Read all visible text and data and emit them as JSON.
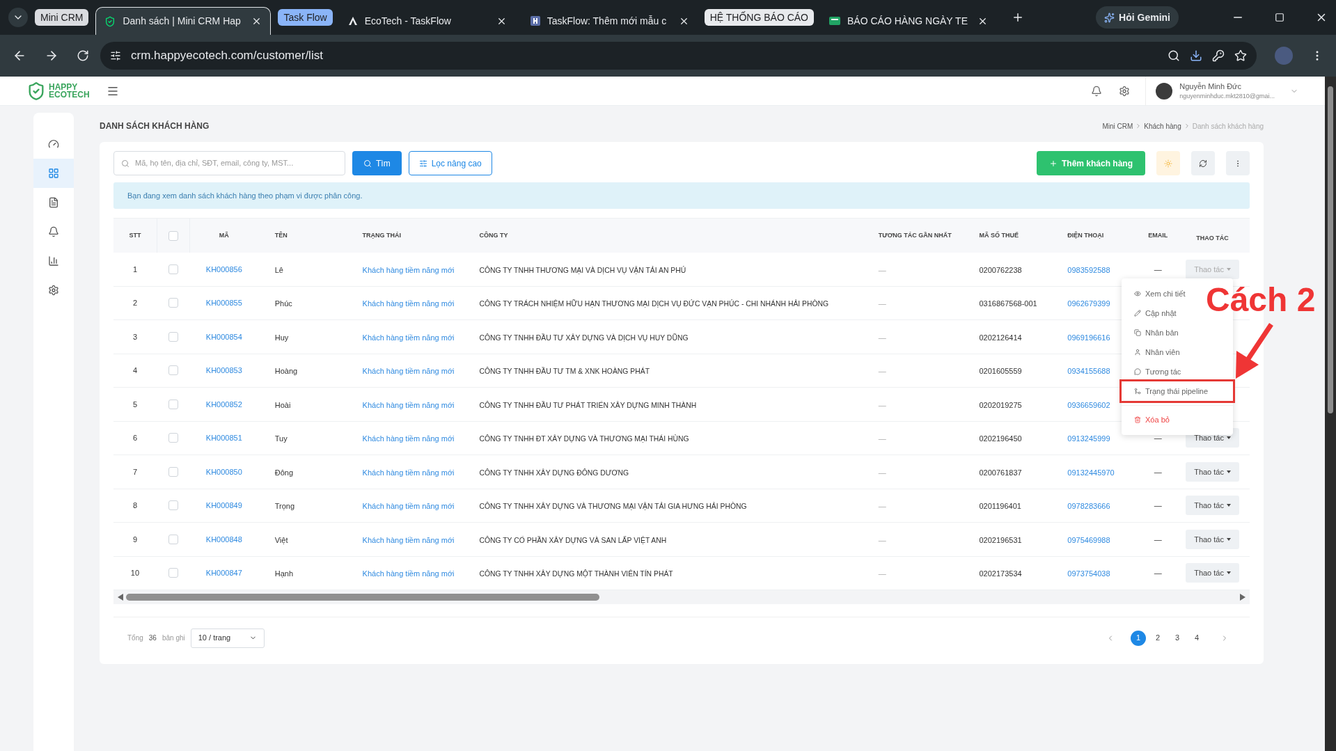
{
  "browser": {
    "tabs": [
      {
        "kind": "group",
        "label": "Mini CRM",
        "color": "#dadce0"
      },
      {
        "kind": "tab",
        "label": "Danh sách | Mini CRM Hap",
        "selected": true
      },
      {
        "kind": "group",
        "label": "Task Flow",
        "color": "#8ab4f8"
      },
      {
        "kind": "tab",
        "label": "EcoTech - TaskFlow",
        "selected": false
      },
      {
        "kind": "tab",
        "label": "TaskFlow: Thêm mới mẫu c",
        "selected": false
      },
      {
        "kind": "group",
        "label": "HỆ THỐNG BÁO CÁO",
        "color": "#e8eaed"
      },
      {
        "kind": "tab",
        "label": "BÁO CÁO HÀNG NGÀY TE",
        "selected": false
      }
    ],
    "gemini": "Hỏi Gemini",
    "url": "crm.happyecotech.com/customer/list"
  },
  "app": {
    "logo_top": "HAPPY",
    "logo_bottom": "ECOTECH",
    "user_name": "Nguyễn Minh Đức",
    "user_email": "nguyenminhduc.mkt2810@gmai..."
  },
  "sidebar": {
    "items": [
      {
        "selected": false
      },
      {
        "selected": true
      },
      {
        "selected": false
      },
      {
        "selected": false
      },
      {
        "selected": false
      },
      {
        "selected": false
      }
    ]
  },
  "page": {
    "title": "DANH SÁCH KHÁCH HÀNG",
    "breadcrumbs": [
      "Mini CRM",
      "Khách hàng",
      "Danh sách khách hàng"
    ]
  },
  "toolbar": {
    "search_placeholder": "Mã, họ tên, địa chỉ, SĐT, email, công ty, MST...",
    "search_button": "Tìm",
    "filter_button": "Lọc nâng cao",
    "add_button": "Thêm khách hàng"
  },
  "notice": "Bạn đang xem danh sách khách hàng theo phạm vi được phân công.",
  "table": {
    "columns": [
      "STT",
      "MÃ",
      "TÊN",
      "TRẠNG THÁI",
      "CÔNG TY",
      "TƯƠNG TÁC GẦN NHẤT",
      "MÃ SỐ THUẾ",
      "ĐIỆN THOẠI",
      "EMAIL",
      "THAO TÁC"
    ],
    "all_checked": false,
    "rows": [
      {
        "stt": "1",
        "checked": false,
        "code": "KH000856",
        "name": "Lê",
        "status": "Khách hàng tiềm năng mới",
        "company": "CÔNG TY TNHH THƯƠNG MẠI VÀ DỊCH VỤ VẬN TẢI AN PHÚ",
        "last": "—",
        "tax": "0200762238",
        "phone": "0983592588",
        "email": "—",
        "action": "Thao tác",
        "open": true
      },
      {
        "stt": "2",
        "checked": false,
        "code": "KH000855",
        "name": "Phúc",
        "status": "Khách hàng tiềm năng mới",
        "company": "CÔNG TY TRÁCH NHIỆM HỮU HẠN THƯƠNG MẠI DỊCH VỤ ĐỨC VẠN PHÚC - CHI NHÁNH HẢI PHÒNG",
        "last": "—",
        "tax": "0316867568-001",
        "phone": "0962679399"
      },
      {
        "stt": "3",
        "checked": false,
        "code": "KH000854",
        "name": "Huy",
        "status": "Khách hàng tiềm năng mới",
        "company": "CÔNG TY TNHH ĐẦU TƯ XÂY DỰNG VÀ DỊCH VỤ HUY DŨNG",
        "last": "—",
        "tax": "0202126414",
        "phone": "0969196616"
      },
      {
        "stt": "4",
        "checked": false,
        "code": "KH000853",
        "name": "Hoàng",
        "status": "Khách hàng tiềm năng mới",
        "company": "CÔNG TY TNHH ĐẦU TƯ TM & XNK HOÀNG PHÁT",
        "last": "—",
        "tax": "0201605559",
        "phone": "0934155688"
      },
      {
        "stt": "5",
        "checked": false,
        "code": "KH000852",
        "name": "Hoài",
        "status": "Khách hàng tiềm năng mới",
        "company": "CÔNG TY TNHH ĐẦU TƯ PHÁT TRIỂN XÂY DỰNG MINH THÀNH",
        "last": "—",
        "tax": "0202019275",
        "phone": "0936659602"
      },
      {
        "stt": "6",
        "checked": false,
        "code": "KH000851",
        "name": "Tuy",
        "status": "Khách hàng tiềm năng mới",
        "company": "CÔNG TY TNHH ĐT XÂY DỰNG VÀ THƯƠNG MẠI THÁI HÙNG",
        "last": "—",
        "tax": "0202196450",
        "phone": "0913245999",
        "email": "—",
        "action": "Thao tác",
        "open": false
      },
      {
        "stt": "7",
        "checked": false,
        "code": "KH000850",
        "name": "Đông",
        "status": "Khách hàng tiềm năng mới",
        "company": "CÔNG TY TNHH XÂY DỰNG ĐÔNG DƯƠNG",
        "last": "—",
        "tax": "0200761837",
        "phone": "09132445970",
        "email": "—",
        "action": "Thao tác",
        "open": false
      },
      {
        "stt": "8",
        "checked": false,
        "code": "KH000849",
        "name": "Trọng",
        "status": "Khách hàng tiềm năng mới",
        "company": "CÔNG TY TNHH XÂY DỰNG VÀ THƯƠNG MẠI VẬN TẢI GIA HƯNG HẢI PHÒNG",
        "last": "—",
        "tax": "0201196401",
        "phone": "0978283666",
        "email": "—",
        "action": "Thao tác",
        "open": false
      },
      {
        "stt": "9",
        "checked": false,
        "code": "KH000848",
        "name": "Việt",
        "status": "Khách hàng tiềm năng mới",
        "company": "CÔNG TY CỔ PHẦN XÂY DỰNG VÀ SAN LẤP VIỆT ANH",
        "last": "—",
        "tax": "0202196531",
        "phone": "0975469988",
        "email": "—",
        "action": "Thao tác",
        "open": false
      },
      {
        "stt": "10",
        "checked": false,
        "code": "KH000847",
        "name": "Hạnh",
        "status": "Khách hàng tiềm năng mới",
        "company": "CÔNG TY TNHH XÂY DỰNG MỘT THÀNH VIÊN TÍN PHÁT",
        "last": "—",
        "tax": "0202173534",
        "phone": "0973754038",
        "email": "—",
        "action": "Thao tác",
        "open": false
      }
    ]
  },
  "menu": {
    "items": [
      {
        "kind": "item",
        "label": "Xem chi tiết",
        "highlighted": false
      },
      {
        "kind": "item",
        "label": "Cập nhật",
        "highlighted": false
      },
      {
        "kind": "item",
        "label": "Nhân bản",
        "highlighted": false
      },
      {
        "kind": "item",
        "label": "Nhân viên",
        "highlighted": false
      },
      {
        "kind": "item",
        "label": "Tương tác",
        "highlighted": false
      },
      {
        "kind": "item",
        "label": "Trạng thái pipeline",
        "highlighted": true
      },
      {
        "kind": "danger",
        "label": "Xóa bỏ",
        "highlighted": false
      }
    ]
  },
  "annotation": {
    "label": "Cách 2"
  },
  "pagination": {
    "total_label": "Tổng",
    "total": "36",
    "unit": "bản ghi",
    "page_size": "10 / trang",
    "pages": [
      {
        "label": "1",
        "selected": true
      },
      {
        "label": "2",
        "selected": false
      },
      {
        "label": "3",
        "selected": false
      },
      {
        "label": "4",
        "selected": false
      }
    ]
  }
}
